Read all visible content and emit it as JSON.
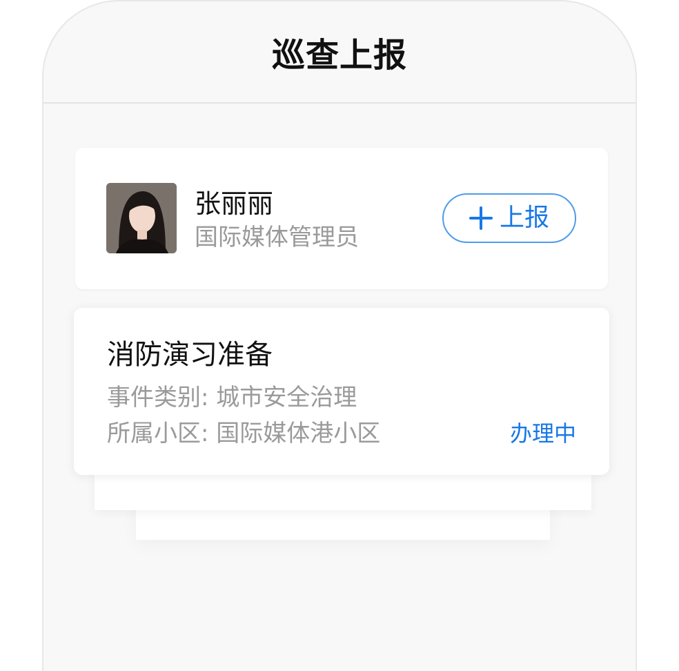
{
  "nav": {
    "title": "巡查上报"
  },
  "user": {
    "name": "张丽丽",
    "role": "国际媒体管理员",
    "report_button": "上报",
    "avatar_icon": "user-photo-icon",
    "plus_icon": "plus-icon"
  },
  "event": {
    "title": "消防演习准备",
    "category_label": "事件类别",
    "category_value": "城市安全治理",
    "area_label": "所属小区",
    "area_value": "国际媒体港小区",
    "status": "办理中"
  },
  "colors": {
    "accent": "#1878e6",
    "button_border": "#4e9bea",
    "secondary_text": "#9a9a9a",
    "background": "#f8f8f8"
  }
}
